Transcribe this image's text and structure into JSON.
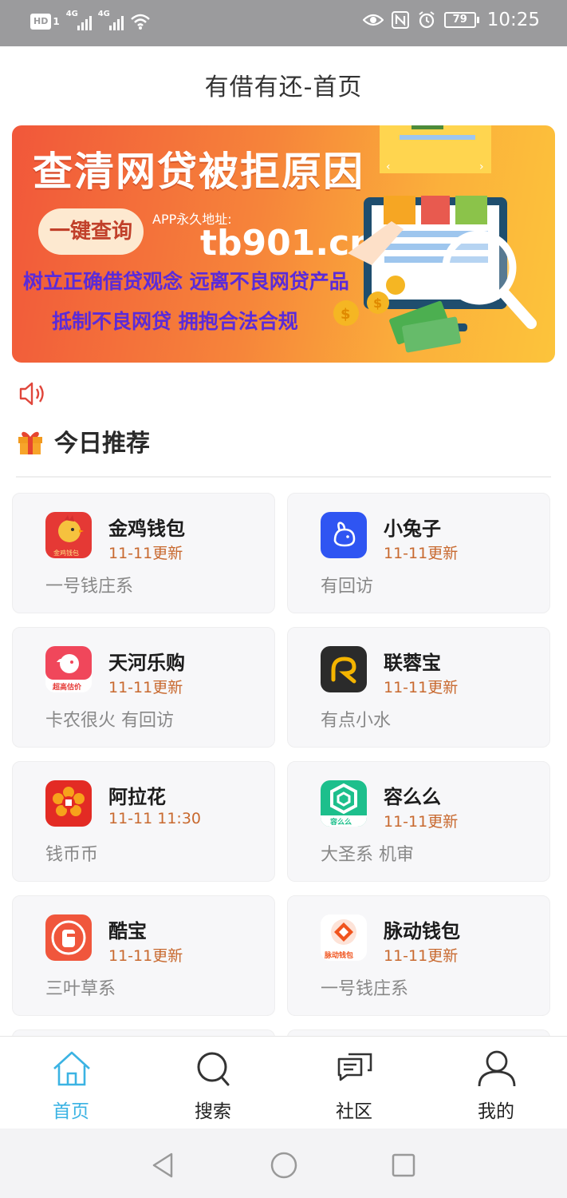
{
  "status_bar": {
    "hd": "HD",
    "sim": "1",
    "net1": "4G",
    "net2": "4G",
    "battery": "79",
    "time": "10:25"
  },
  "header": {
    "title": "有借有还-首页"
  },
  "banner": {
    "headline": "查清网贷被拒原因",
    "button": "一键查询",
    "addr_label": "APP永久地址:",
    "url": "tb901.cn",
    "line1": "树立正确借贷观念 远离不良网贷产品",
    "line2": "抵制不良网贷 拥抱合法合规",
    "illustration_icon": "computer-magnifier-money-illustration",
    "colors": {
      "start": "#f1573a",
      "end": "#fcc43b",
      "text_accent": "#5b2bd8"
    }
  },
  "notice": {
    "icon": "speaker-icon",
    "color": "#e0463b"
  },
  "section": {
    "icon": "gift-icon",
    "title": "今日推荐"
  },
  "cards": [
    {
      "name": "金鸡钱包",
      "date": "11-11更新",
      "desc": "一号钱庄系",
      "icon": "golden-rooster-icon",
      "icon_bg": "#e53935",
      "icon_text": "金鸡钱包"
    },
    {
      "name": "小兔子",
      "date": "11-11更新",
      "desc": "有回访",
      "icon": "rabbit-icon",
      "icon_bg": "#2f55f2",
      "icon_text": ""
    },
    {
      "name": "天河乐购",
      "date": "11-11更新",
      "desc": "卡农很火 有回访",
      "icon": "bird-icon",
      "icon_bg": "#ffffff",
      "icon_text": "超高估价"
    },
    {
      "name": "联蓉宝",
      "date": "11-11更新",
      "desc": "有点小水",
      "icon": "r-logo-icon",
      "icon_bg": "#2b2b2b",
      "icon_text": ""
    },
    {
      "name": "阿拉花",
      "date": "11-11 11:30",
      "desc": "钱币币",
      "icon": "flower-icon",
      "icon_bg": "#e32b24",
      "icon_text": ""
    },
    {
      "name": "容么么",
      "date": "11-11更新",
      "desc": "大圣系 机审",
      "icon": "hexagon-logo-icon",
      "icon_bg": "#1dbf8c",
      "icon_text": "容么么"
    },
    {
      "name": "酷宝",
      "date": "11-11更新",
      "desc": "三叶草系",
      "icon": "lock-tag-icon",
      "icon_bg": "#f0563c",
      "icon_text": ""
    },
    {
      "name": "脉动钱包",
      "date": "11-11更新",
      "desc": "一号钱庄系",
      "icon": "pulse-diamond-icon",
      "icon_bg": "#ffffff",
      "icon_text": "脉动钱包"
    }
  ],
  "bottom_nav": [
    {
      "label": "首页",
      "icon": "home-icon",
      "active": true
    },
    {
      "label": "搜索",
      "icon": "search-icon",
      "active": false
    },
    {
      "label": "社区",
      "icon": "chat-icon",
      "active": false
    },
    {
      "label": "我的",
      "icon": "user-icon",
      "active": false
    }
  ],
  "system_nav": [
    "back-icon",
    "home-circle-icon",
    "recents-icon"
  ],
  "accent_color": "#3bb3e3"
}
